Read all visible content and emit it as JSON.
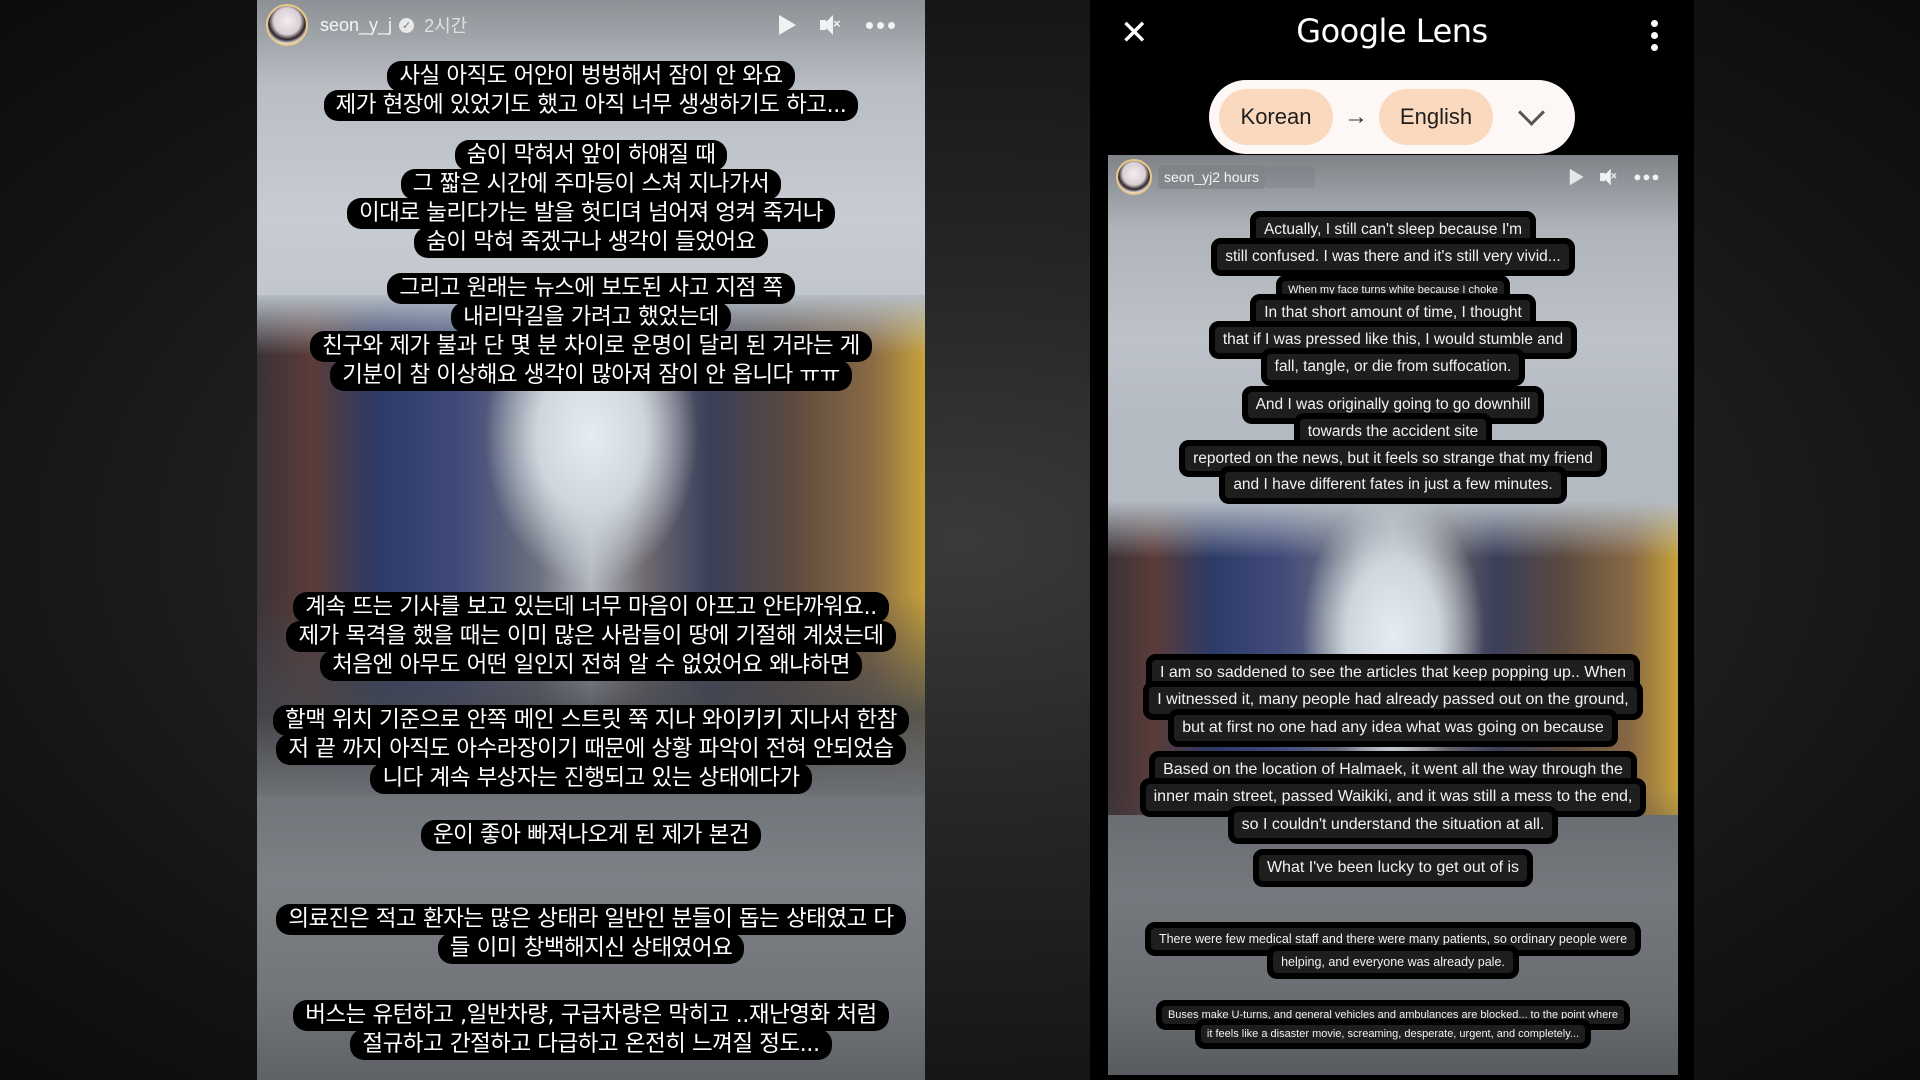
{
  "original_story": {
    "username": "seon_y_j",
    "verified": true,
    "time": "2시간",
    "icons": [
      "play-icon",
      "mute-icon",
      "more-icon"
    ],
    "captions": [
      [
        "사실 아직도 어안이 벙벙해서 잠이 안 와요",
        "제가 현장에 있었기도 했고 아직 너무 생생하기도 하고..."
      ],
      [
        "숨이 막혀서 앞이 하얘질 때",
        "그 짧은 시간에 주마등이 스쳐 지나가서",
        "이대로 눌리다가는 발을 헛디뎌 넘어져 엉켜 죽거나",
        "숨이 막혀 죽겠구나 생각이 들었어요"
      ],
      [
        "그리고 원래는 뉴스에 보도된 사고 지점 쪽",
        "내리막길을 가려고 했었는데",
        "친구와 제가 불과 단 몇 분 차이로 운명이 달리 된 거라는 게",
        "기분이 참 이상해요 생각이 많아져 잠이 안 옵니다 ㅠㅠ"
      ],
      [
        "계속 뜨는 기사를 보고 있는데 너무 마음이 아프고 안타까워요..",
        "제가 목격을 했을 때는 이미 많은 사람들이 땅에 기절해 계셨는데",
        "처음엔 아무도 어떤 일인지 전혀 알 수 없었어요 왜냐하면"
      ],
      [
        "할맥 위치 기준으로 안쪽 메인 스트릿 쭉 지나 와이키키 지나서 한참",
        "저 끝 까지 아직도 아수라장이기 때문에 상황 파악이 전혀 안되었습",
        "니다 계속 부상자는 진행되고 있는 상태에다가"
      ],
      [
        "운이 좋아 빠져나오게 된 제가 본건"
      ],
      [
        "의료진은 적고 환자는 많은 상태라 일반인 분들이 돕는 상태였고 다",
        "들 이미 창백해지신 상태였어요"
      ],
      [
        "버스는 유턴하고 ,일반차량, 구급차량은 막히고 ..재난영화 처럼",
        "절규하고 간절하고 다급하고  온전히 느껴질 정도..."
      ]
    ]
  },
  "lens": {
    "title_brand": "Google",
    "title_product": "Lens",
    "close_icon": "close-icon",
    "menu_icon": "more-vert-icon",
    "source_language": "Korean",
    "target_language": "English",
    "arrow": "→",
    "translated_story": {
      "header": "seon_yj2 hours",
      "captions": [
        [
          "Actually, I still can't sleep because I'm",
          "still confused. I was there and it's still very vivid..."
        ],
        [
          "When my face turns white because I choke",
          "In that short amount of time, I thought",
          "that if I was pressed like this, I would stumble and",
          "fall, tangle, or die from suffocation."
        ],
        [
          "And I was originally going to go downhill",
          "towards the accident site",
          "reported on the news, but it feels so strange that my friend",
          "and I have different fates in just a few minutes."
        ],
        [
          "I am so saddened to see the articles that keep popping up.. When",
          "I witnessed it, many people had already passed out on the ground,",
          "but at first no one had any idea what was going on because"
        ],
        [
          "Based on the location of Halmaek, it went all the way through the",
          "inner main street, passed Waikiki, and it was still a mess to the end,",
          "so I couldn't understand the situation at all."
        ],
        [
          "What I've been lucky to get out of is"
        ],
        [
          "There were few medical staff and there were many patients, so ordinary people were",
          "helping, and everyone was already pale."
        ],
        [
          "Buses make U-turns, and general vehicles and ambulances are blocked... to the point where",
          "it feels like a disaster movie, screaming, desperate, urgent, and completely..."
        ]
      ]
    }
  }
}
